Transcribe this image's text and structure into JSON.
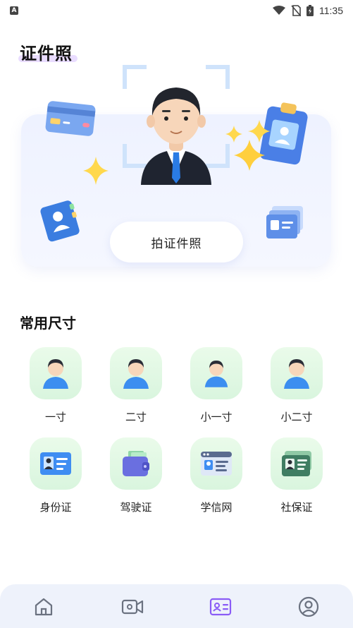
{
  "status": {
    "time": "11:35",
    "notif_icon": "a-notification-icon"
  },
  "header": {
    "title": "证件照"
  },
  "hero": {
    "capture_button": "拍证件照"
  },
  "common_sizes": {
    "title": "常用尺寸",
    "items": [
      {
        "label": "一寸",
        "icon": "person-icon"
      },
      {
        "label": "二寸",
        "icon": "person-icon"
      },
      {
        "label": "小一寸",
        "icon": "person-icon"
      },
      {
        "label": "小二寸",
        "icon": "person-icon"
      },
      {
        "label": "身份证",
        "icon": "id-card-icon"
      },
      {
        "label": "驾驶证",
        "icon": "wallet-icon"
      },
      {
        "label": "学信网",
        "icon": "web-card-icon"
      },
      {
        "label": "社保证",
        "icon": "social-card-icon"
      }
    ]
  },
  "nav": {
    "items": [
      {
        "name": "home",
        "active": false
      },
      {
        "name": "video",
        "active": false
      },
      {
        "name": "id-photo",
        "active": true
      },
      {
        "name": "profile",
        "active": false
      }
    ],
    "active_color": "#8a5cf6",
    "inactive_color": "#6b7280"
  }
}
